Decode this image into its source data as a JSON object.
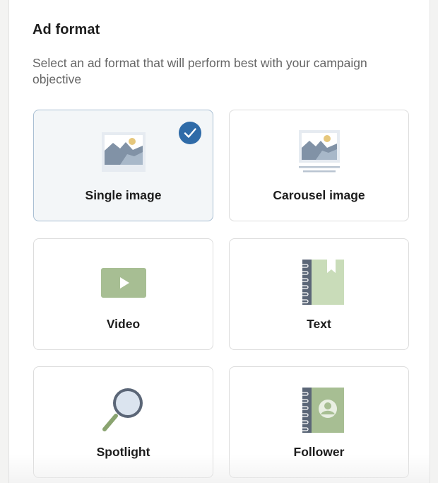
{
  "section": {
    "title": "Ad format",
    "subtitle": "Select an ad format that will perform best with your campaign objective"
  },
  "formats": [
    {
      "label": "Single image",
      "icon": "single-image-icon",
      "selected": true
    },
    {
      "label": "Carousel image",
      "icon": "carousel-image-icon",
      "selected": false
    },
    {
      "label": "Video",
      "icon": "video-icon",
      "selected": false
    },
    {
      "label": "Text",
      "icon": "text-icon",
      "selected": false
    },
    {
      "label": "Spotlight",
      "icon": "spotlight-icon",
      "selected": false
    },
    {
      "label": "Follower",
      "icon": "follower-icon",
      "selected": false
    }
  ],
  "colors": {
    "accent": "#2f6ba8",
    "selected_bg": "#f3f6f8",
    "icon_green": "#a7be93",
    "icon_slate": "#7d8ea2"
  }
}
